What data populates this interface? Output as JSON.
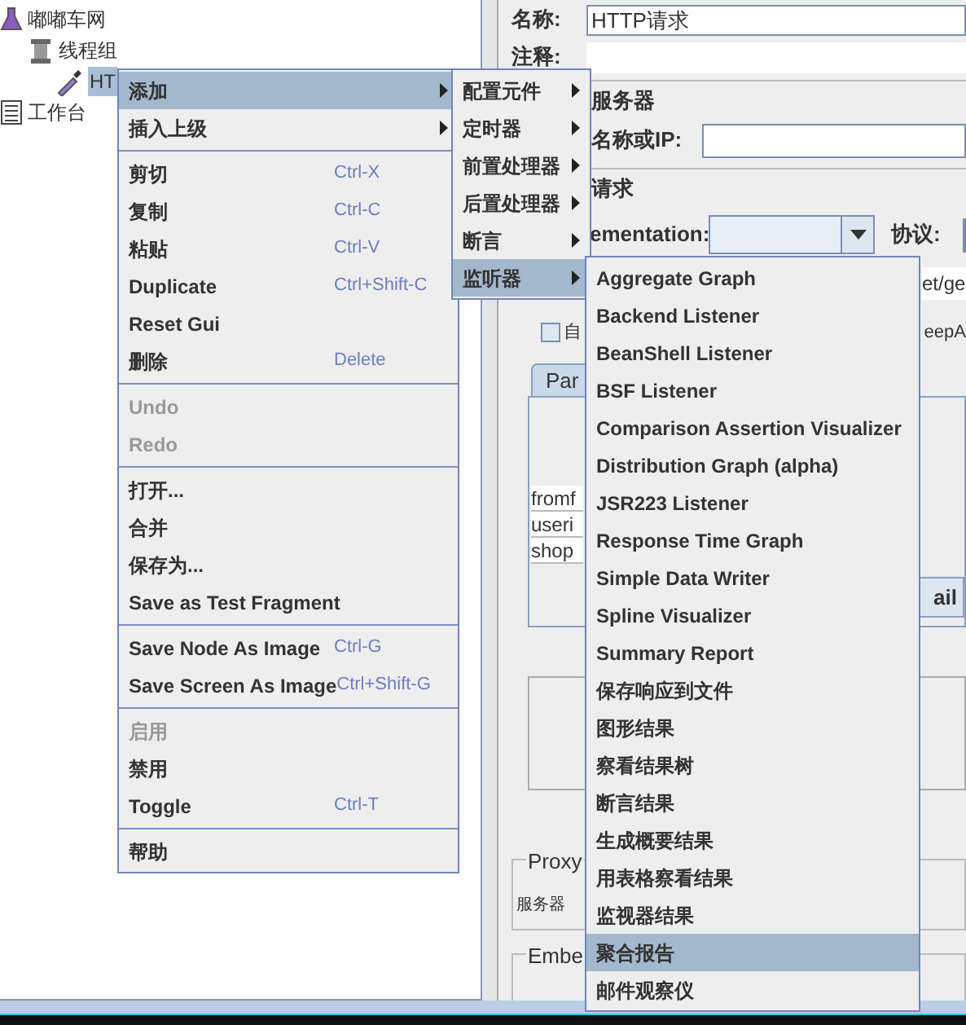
{
  "tree": [
    {
      "label": "嘟嘟车网",
      "kind": "test-plan",
      "selected": false,
      "children": [
        {
          "label": "线程组",
          "kind": "thread-group",
          "selected": false,
          "children": [
            {
              "label": "HT",
              "kind": "sampler",
              "selected": true
            }
          ]
        }
      ]
    },
    {
      "label": "工作台",
      "kind": "workbench",
      "selected": false
    }
  ],
  "form": {
    "name_label": "名称:",
    "name_value": "HTTP请求",
    "comment_label": "注释:",
    "server_section": "服务器",
    "server_label": "名称或IP:",
    "request_section": "请求",
    "implementation_label": "ementation:",
    "protocol_label": "协议:",
    "path_value": "et/ge",
    "checkbox_label": "自",
    "checkbox_checked": false,
    "keepalive_label": "eepA",
    "tab_label": "Par",
    "table_rows": [
      "fromf",
      "useri",
      "shop"
    ],
    "button_label": "ail",
    "proxy_section": "Proxy",
    "proxy_server_label": "服务器",
    "embedded_section": "Embe"
  },
  "context_menu": [
    {
      "kind": "item",
      "label": "添加",
      "submenu": true,
      "selected": true,
      "disabled": false
    },
    {
      "kind": "item",
      "label": "插入上级",
      "submenu": true,
      "selected": false,
      "disabled": false
    },
    {
      "kind": "separator"
    },
    {
      "kind": "item",
      "label": "剪切",
      "shortcut": "Ctrl-X",
      "submenu": false,
      "selected": false,
      "disabled": false
    },
    {
      "kind": "item",
      "label": "复制",
      "shortcut": "Ctrl-C",
      "submenu": false,
      "selected": false,
      "disabled": false
    },
    {
      "kind": "item",
      "label": "粘贴",
      "shortcut": "Ctrl-V",
      "submenu": false,
      "selected": false,
      "disabled": false
    },
    {
      "kind": "item",
      "label": "Duplicate",
      "shortcut": "Ctrl+Shift-C",
      "submenu": false,
      "selected": false,
      "disabled": false
    },
    {
      "kind": "item",
      "label": "Reset Gui",
      "submenu": false,
      "selected": false,
      "disabled": false
    },
    {
      "kind": "item",
      "label": "删除",
      "shortcut": "Delete",
      "submenu": false,
      "selected": false,
      "disabled": false
    },
    {
      "kind": "separator"
    },
    {
      "kind": "item",
      "label": "Undo",
      "submenu": false,
      "selected": false,
      "disabled": true
    },
    {
      "kind": "item",
      "label": "Redo",
      "submenu": false,
      "selected": false,
      "disabled": true
    },
    {
      "kind": "separator"
    },
    {
      "kind": "item",
      "label": "打开...",
      "submenu": false,
      "selected": false,
      "disabled": false
    },
    {
      "kind": "item",
      "label": "合并",
      "submenu": false,
      "selected": false,
      "disabled": false
    },
    {
      "kind": "item",
      "label": "保存为...",
      "submenu": false,
      "selected": false,
      "disabled": false
    },
    {
      "kind": "item",
      "label": "Save as Test Fragment",
      "submenu": false,
      "selected": false,
      "disabled": false
    },
    {
      "kind": "separator"
    },
    {
      "kind": "item",
      "label": "Save Node As Image",
      "shortcut": "Ctrl-G",
      "submenu": false,
      "selected": false,
      "disabled": false
    },
    {
      "kind": "item",
      "label": "Save Screen As Image",
      "shortcut": "Ctrl+Shift-G",
      "submenu": false,
      "selected": false,
      "disabled": false
    },
    {
      "kind": "separator"
    },
    {
      "kind": "item",
      "label": "启用",
      "submenu": false,
      "selected": false,
      "disabled": true
    },
    {
      "kind": "item",
      "label": "禁用",
      "submenu": false,
      "selected": false,
      "disabled": false
    },
    {
      "kind": "item",
      "label": "Toggle",
      "shortcut": "Ctrl-T",
      "submenu": false,
      "selected": false,
      "disabled": false
    },
    {
      "kind": "separator"
    },
    {
      "kind": "item",
      "label": "帮助",
      "submenu": false,
      "selected": false,
      "disabled": false
    }
  ],
  "add_submenu": [
    {
      "label": "配置元件",
      "submenu": true,
      "selected": false
    },
    {
      "label": "定时器",
      "submenu": true,
      "selected": false
    },
    {
      "label": "前置处理器",
      "submenu": true,
      "selected": false
    },
    {
      "label": "后置处理器",
      "submenu": true,
      "selected": false
    },
    {
      "label": "断言",
      "submenu": true,
      "selected": false
    },
    {
      "label": "监听器",
      "submenu": true,
      "selected": true
    }
  ],
  "listener_submenu": [
    {
      "label": "Aggregate Graph",
      "selected": false
    },
    {
      "label": "Backend Listener",
      "selected": false
    },
    {
      "label": "BeanShell Listener",
      "selected": false
    },
    {
      "label": "BSF Listener",
      "selected": false
    },
    {
      "label": "Comparison Assertion Visualizer",
      "selected": false
    },
    {
      "label": "Distribution Graph (alpha)",
      "selected": false
    },
    {
      "label": "JSR223 Listener",
      "selected": false
    },
    {
      "label": "Response Time Graph",
      "selected": false
    },
    {
      "label": "Simple Data Writer",
      "selected": false
    },
    {
      "label": "Spline Visualizer",
      "selected": false
    },
    {
      "label": "Summary Report",
      "selected": false
    },
    {
      "label": "保存响应到文件",
      "selected": false
    },
    {
      "label": "图形结果",
      "selected": false
    },
    {
      "label": "察看结果树",
      "selected": false
    },
    {
      "label": "断言结果",
      "selected": false
    },
    {
      "label": "生成概要结果",
      "selected": false
    },
    {
      "label": "用表格察看结果",
      "selected": false
    },
    {
      "label": "监视器结果",
      "selected": false
    },
    {
      "label": "聚合报告",
      "selected": true
    },
    {
      "label": "邮件观察仪",
      "selected": false
    }
  ]
}
